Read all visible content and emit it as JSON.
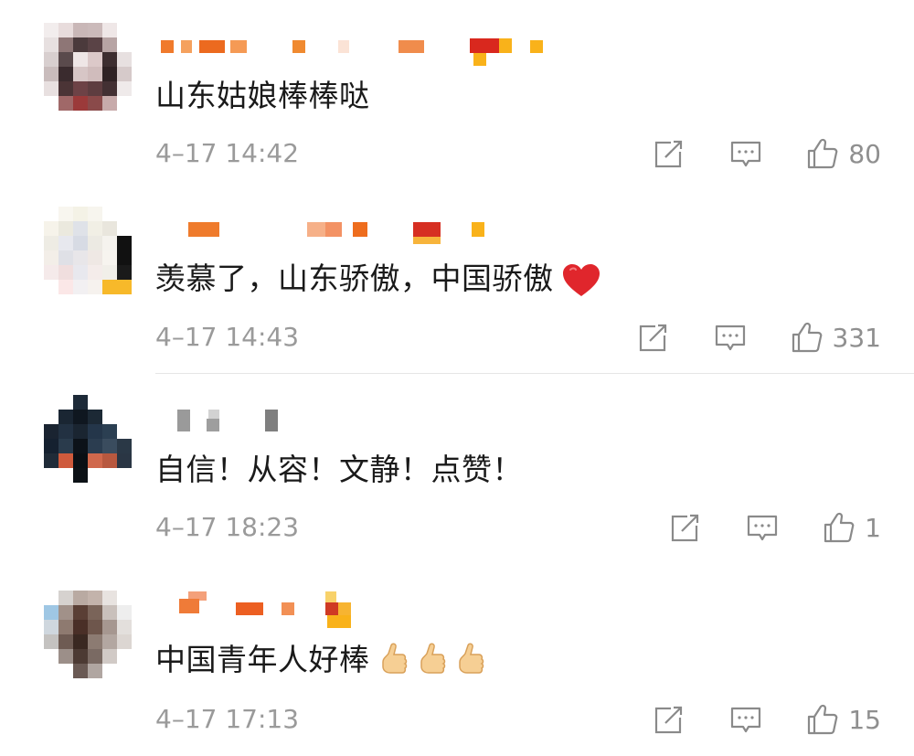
{
  "comments": [
    {
      "text": "山东姑娘棒棒哒",
      "time": "4–17 14:42",
      "likes": "80"
    },
    {
      "text": "羡慕了，山东骄傲，中国骄傲",
      "time": "4–17 14:43",
      "likes": "331"
    },
    {
      "text": "自信！从容！文静！点赞！",
      "time": "4–17 18:23",
      "likes": "1"
    },
    {
      "text": "中国青年人好棒",
      "time": "4–17 17:13",
      "likes": "15"
    }
  ],
  "icons": {
    "share": "share-icon",
    "comment": "comment-icon",
    "like": "thumbs-up-icon",
    "heart": "red-heart-emoji",
    "thumbs_emoji": "thumbs-up-emoji"
  },
  "colors": {
    "text": "#1a1a1a",
    "meta": "#9a9a9a",
    "icon": "#8a8a8a",
    "heart": "#e0262c",
    "username_orange": "#f07a2c",
    "username_red": "#d9281e",
    "username_yellow": "#f9b21a"
  }
}
